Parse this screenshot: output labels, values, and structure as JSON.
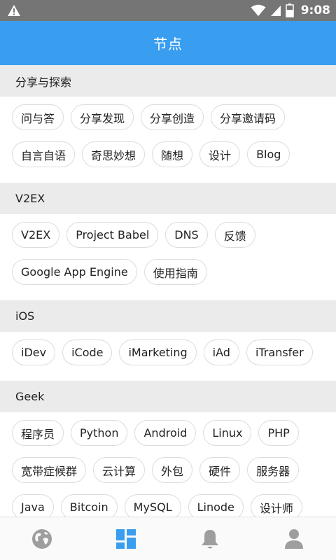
{
  "status_bar": {
    "time": "9:08"
  },
  "app_bar": {
    "title": "节点"
  },
  "sections": [
    {
      "title": "分享与探索",
      "tags": [
        "问与答",
        "分享发现",
        "分享创造",
        "分享邀请码",
        "自言自语",
        "奇思妙想",
        "随想",
        "设计",
        "Blog"
      ]
    },
    {
      "title": "V2EX",
      "tags": [
        "V2EX",
        "Project Babel",
        "DNS",
        "反馈",
        "Google App Engine",
        "使用指南"
      ]
    },
    {
      "title": "iOS",
      "tags": [
        "iDev",
        "iCode",
        "iMarketing",
        "iAd",
        "iTransfer"
      ]
    },
    {
      "title": "Geek",
      "tags": [
        "程序员",
        "Python",
        "Android",
        "Linux",
        "PHP",
        "宽带症候群",
        "云计算",
        "外包",
        "硬件",
        "服务器",
        "Java",
        "Bitcoin",
        "MySQL",
        "Linode",
        "设计师"
      ]
    }
  ],
  "bottom_nav": [
    {
      "icon": "globe-icon",
      "active": false
    },
    {
      "icon": "nodes-grid-icon",
      "active": true
    },
    {
      "icon": "bell-icon",
      "active": false
    },
    {
      "icon": "person-icon",
      "active": false
    }
  ],
  "colors": {
    "primary": "#3a9ef0",
    "inactive_icon": "#9e9e9e",
    "section_bg": "#ebebeb"
  }
}
